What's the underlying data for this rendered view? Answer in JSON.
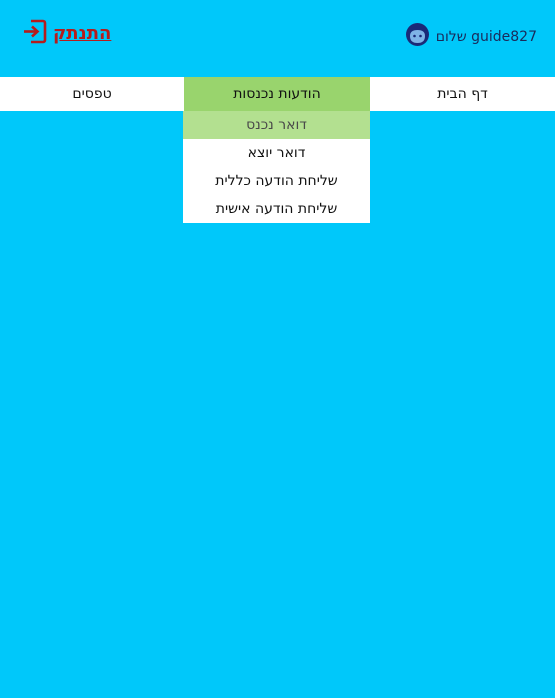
{
  "header": {
    "logout_label": "התנתק",
    "greeting": "שלום guide827"
  },
  "nav": {
    "left": "טפסים",
    "middle": "הודעות נכנסות",
    "right": "דף הבית"
  },
  "dropdown": {
    "items": [
      "דואר נכנס",
      "דואר יוצא",
      "שליחת הודעה כללית",
      "שליחת הודעה אישית"
    ]
  },
  "colors": {
    "background": "#00c8fa",
    "nav_active": "#99d46d",
    "dropdown_active": "#b3e090",
    "logout": "#b61c1c"
  }
}
